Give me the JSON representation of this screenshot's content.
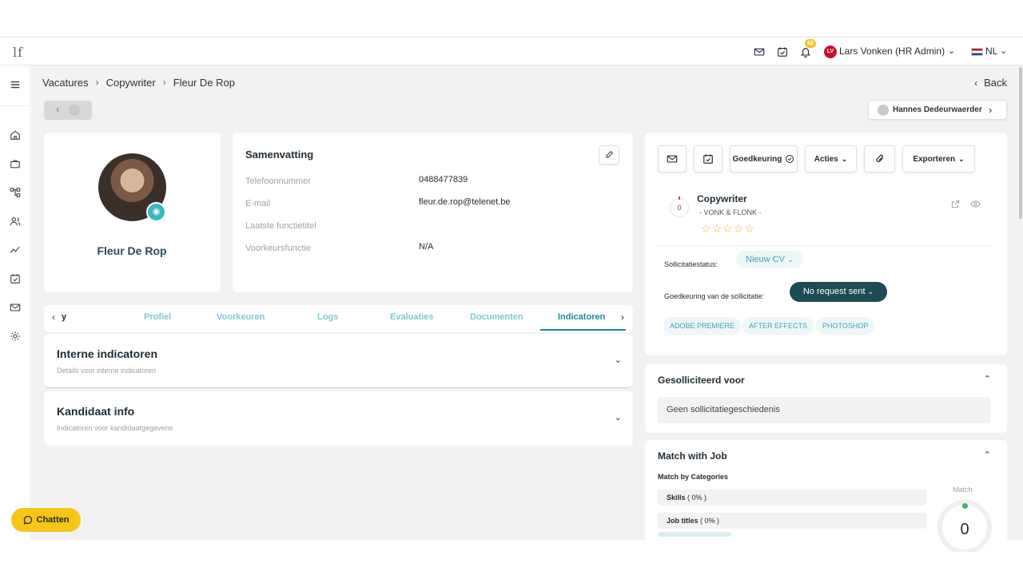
{
  "topbar": {
    "logo": "lf",
    "notification_count": "62",
    "user_initials": "LV",
    "user_name": "Lars Vonken (HR Admin)",
    "language": "NL"
  },
  "breadcrumb": {
    "items": [
      "Vacatures",
      "Copywriter",
      "Fleur De Rop"
    ],
    "back_label": "Back"
  },
  "next_candidate": "Hannes Dedeurwaerder",
  "profile": {
    "name": "Fleur De Rop"
  },
  "summary": {
    "title": "Samenvatting",
    "fields": [
      {
        "label": "Telefoonnummer",
        "value": "0488477839"
      },
      {
        "label": "E-mail",
        "value": "fleur.de.rop@telenet.be"
      },
      {
        "label": "Laatste functietitel",
        "value": ""
      },
      {
        "label": "Voorkeursfunctie",
        "value": "N/A"
      }
    ]
  },
  "tabs": {
    "partial_label": "y",
    "items": [
      "Profiel",
      "Voorkeuren",
      "Logs",
      "Evaluaties",
      "Documenten",
      "Indicatoren"
    ],
    "active": "Indicatoren"
  },
  "accordions": [
    {
      "title": "Interne indicatoren",
      "subtitle": "Details voor interne indicatoren"
    },
    {
      "title": "Kandidaat info",
      "subtitle": "Indicatoren voor kandidaatgegevens"
    }
  ],
  "actions": {
    "approval_label": "Goedkeuring",
    "actions_label": "Acties",
    "export_label": "Exporteren"
  },
  "application": {
    "score": "0",
    "job_title": "Copywriter",
    "company": "- VONK & FLONK -",
    "rating": 0,
    "rating_max": 5,
    "status_label": "Sollicitatiestatus:",
    "status_value": "Nieuw CV",
    "approval_label": "Goedkeuring van de sollicitatie:",
    "approval_value": "No request sent",
    "skills": [
      "ADOBE PREMIERE",
      "AFTER EFFECTS",
      "PHOTOSHOP"
    ]
  },
  "applied_for": {
    "title": "Gesolliciteerd voor",
    "empty": "Geen sollicitatiegeschiedenis"
  },
  "match": {
    "title": "Match with Job",
    "subtitle": "Match by Categories",
    "label": "Match",
    "value": "0",
    "categories": [
      {
        "name": "Skills",
        "pct": "( 0% )"
      },
      {
        "name": "Job titles",
        "pct": "( 0% )"
      }
    ]
  },
  "chat": {
    "label": "Chatten"
  },
  "colors": {
    "accent": "#1b8b9a",
    "dark_pill": "#1c4a55",
    "chat": "#f5c518",
    "star": "#e5b92c"
  }
}
